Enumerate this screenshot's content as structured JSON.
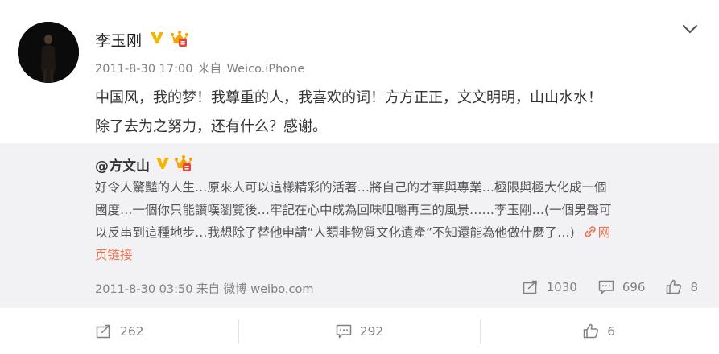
{
  "post": {
    "username": "李玉刚",
    "timestamp": "2011-8-30 17:00",
    "source_prefix": "来自",
    "source": "Weico.iPhone",
    "text_line1": "中国风，我的梦！我尊重的人，我喜欢的词！方方正正，文文明明，山山水水！",
    "text_line2": "除了去为之努力，还有什么？感谢。",
    "icons": {
      "verified": "verified-v-badge",
      "member": "crown-member-badge",
      "menu": "chevron-down-icon"
    }
  },
  "repost": {
    "original_user": "@方文山",
    "line1": "好令人驚豔的人生…原來人可以這樣精彩的活著…將自己的才華與專業…極限與極大化成一個",
    "line2": "國度…一個你只能讚嘆瀏覽後…牢記在心中成為回味咀嚼再三的風景……李玉剛…(一個男聲可",
    "line3": "以反串到這種地步…我想除了替他申請“人類非物質文化遺產”不知還能為他做什麼了…)",
    "link_icon": "link-icon",
    "link_label_part1": "网",
    "link_label_part2": "页链接",
    "timestamp": "2011-8-30 03:50",
    "source_prefix": "来自",
    "source": "微博 weibo.com",
    "forward_count": "1030",
    "comment_count": "696",
    "like_count": "8"
  },
  "actions": {
    "forward_count": "262",
    "comment_count": "292",
    "like_count": "6"
  },
  "colors": {
    "link": "#eb7350",
    "verified": "#f4b400",
    "muted": "#808080",
    "repost_bg": "#f2f2f5"
  }
}
